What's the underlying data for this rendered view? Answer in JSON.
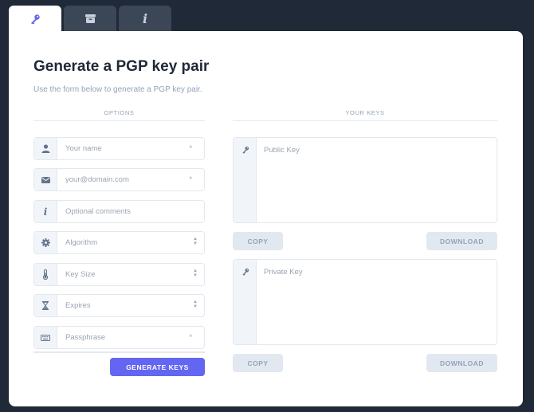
{
  "tabs": [
    {
      "icon": "key-icon",
      "active": true
    },
    {
      "icon": "archive-icon",
      "active": false
    },
    {
      "icon": "info-icon",
      "active": false
    }
  ],
  "page": {
    "title": "Generate a PGP key pair",
    "subtitle": "Use the form below to generate a PGP key pair."
  },
  "options": {
    "heading": "OPTIONS",
    "name": {
      "placeholder": "Your name",
      "required": "*"
    },
    "email": {
      "placeholder": "your@domain.com",
      "required": "*"
    },
    "comments": {
      "placeholder": "Optional comments"
    },
    "algorithm": {
      "placeholder": "Algorithm"
    },
    "key_size": {
      "placeholder": "Key Size"
    },
    "expires": {
      "placeholder": "Expires"
    },
    "passphrase": {
      "placeholder": "Passphrase",
      "required": "*"
    },
    "generate_label": "GENERATE KEYS"
  },
  "keys": {
    "heading": "YOUR KEYS",
    "public": {
      "placeholder": "Public Key",
      "copy_label": "COPY",
      "download_label": "DOWNLOAD"
    },
    "private": {
      "placeholder": "Private Key",
      "copy_label": "COPY",
      "download_label": "DOWNLOAD"
    }
  },
  "colors": {
    "accent": "#6366f1",
    "background": "#1f2937",
    "tab_inactive": "#3b4657"
  }
}
